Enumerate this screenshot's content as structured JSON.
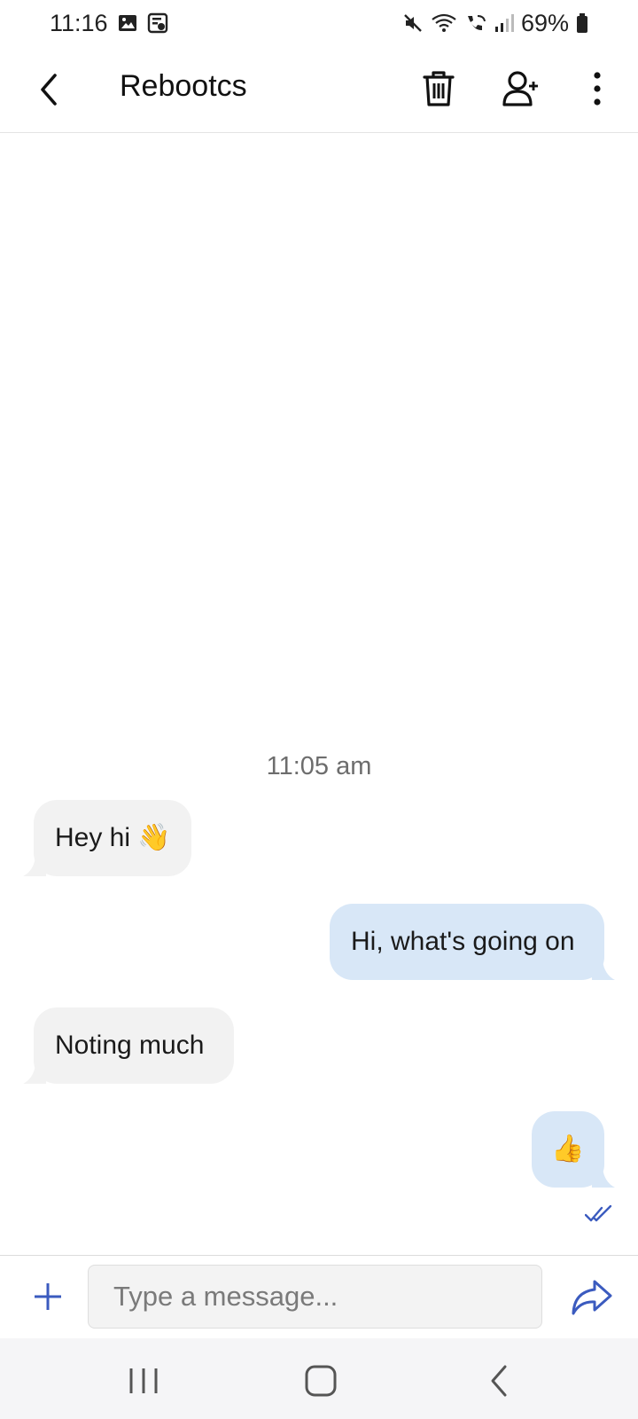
{
  "status_bar": {
    "time": "11:16",
    "battery": "69%",
    "icons": [
      "gallery-icon",
      "screenshot-icon",
      "mute-icon",
      "wifi-icon",
      "wifi-calling-icon",
      "signal-icon",
      "battery-icon"
    ]
  },
  "header": {
    "title": "Rebootcs",
    "icons": [
      "back-arrow-icon",
      "trash-icon",
      "add-user-icon",
      "more-vertical-icon"
    ]
  },
  "chat": {
    "timestamp": "11:05 am",
    "messages": [
      {
        "direction": "incoming",
        "text": "Hey hi 👋"
      },
      {
        "direction": "outgoing",
        "text": "Hi, what's going on"
      },
      {
        "direction": "incoming",
        "text": "Noting much"
      },
      {
        "direction": "outgoing",
        "text": "👍"
      }
    ],
    "read_status_icon": "double-check-icon"
  },
  "composer": {
    "placeholder": "Type a message...",
    "value": "",
    "icons": [
      "plus-icon",
      "send-share-icon"
    ]
  },
  "nav_bar": {
    "icons": [
      "recents-icon",
      "home-icon",
      "nav-back-icon"
    ]
  },
  "colors": {
    "accent": "#3b5bbf",
    "incoming_bubble": "#f2f2f2",
    "outgoing_bubble": "#d8e7f7"
  }
}
